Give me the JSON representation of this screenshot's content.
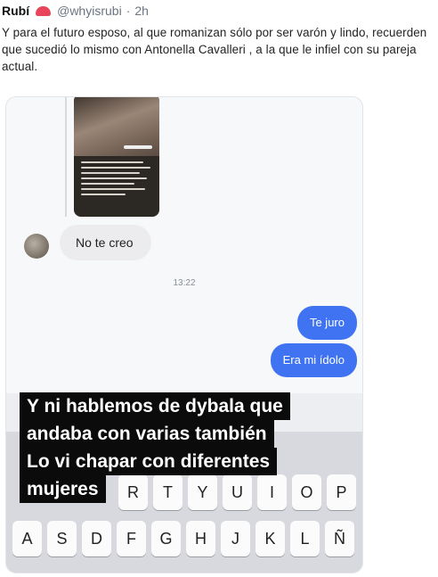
{
  "tweet": {
    "author": "Rubí",
    "handle": "@whyisrubi",
    "separator": "·",
    "time": "2h",
    "text": "Y para el futuro esposo, al que romanizan sólo por ser varón y lindo, recuerden que sucedió lo mismo con Antonella Cavalleri , a la que le infiel con su pareja actual."
  },
  "chat": {
    "incoming_message": "No te creo",
    "timestamp": "13:22",
    "outgoing_messages": [
      "Te juro",
      "Era mi ídolo"
    ]
  },
  "overlay": {
    "lines": [
      "Y ni hablemos de dybala que",
      "andaba con varias también",
      "Lo vi chapar con diferentes",
      "mujeres"
    ]
  },
  "keyboard": {
    "row1_visible": [
      "R",
      "T",
      "Y",
      "U",
      "I",
      "O",
      "P"
    ],
    "row2": [
      "A",
      "S",
      "D",
      "F",
      "G",
      "H",
      "J",
      "K",
      "L",
      "Ñ"
    ]
  }
}
